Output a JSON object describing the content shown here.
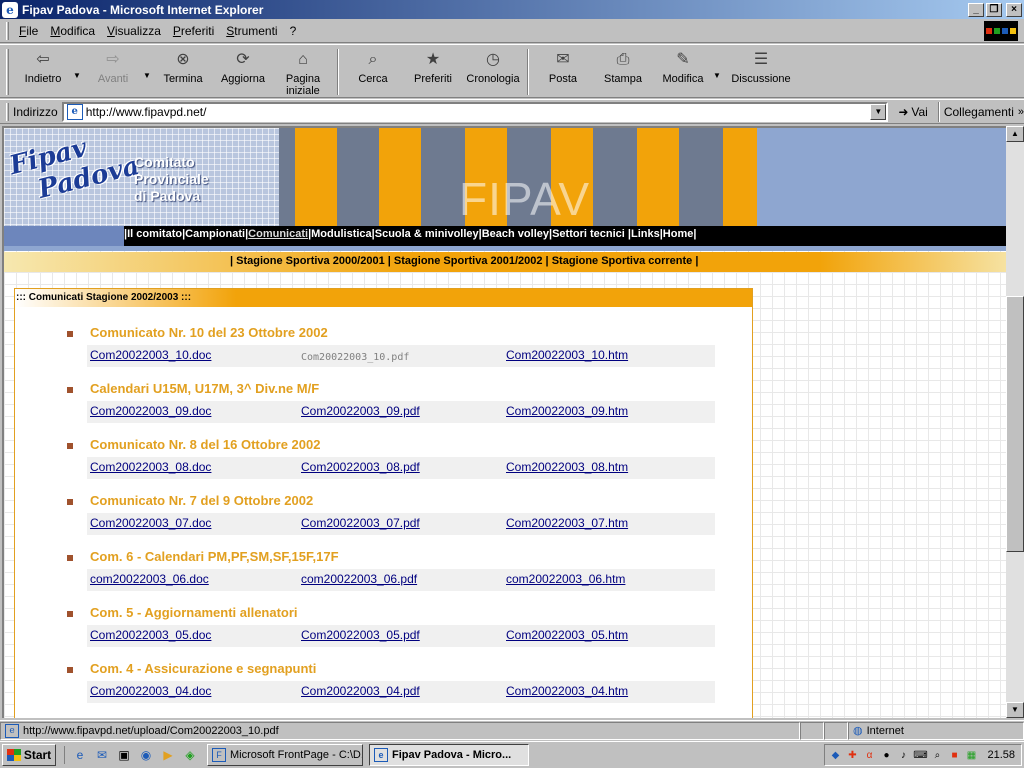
{
  "window": {
    "title": "Fipav Padova - Microsoft Internet Explorer",
    "buttons": [
      "_",
      "❐",
      "×"
    ]
  },
  "menu": [
    "File",
    "Modifica",
    "Visualizza",
    "Preferiti",
    "Strumenti",
    "?"
  ],
  "toolbar": {
    "back": "Indietro",
    "forward": "Avanti",
    "stop": "Termina",
    "refresh": "Aggiorna",
    "home": "Pagina iniziale",
    "search": "Cerca",
    "favorites": "Preferiti",
    "history": "Cronologia",
    "mail": "Posta",
    "print": "Stampa",
    "edit": "Modifica",
    "discuss": "Discussione"
  },
  "address": {
    "label": "Indirizzo",
    "url": "http://www.fipavpd.net/",
    "go": "Vai",
    "links": "Collegamenti"
  },
  "banner": {
    "logo_line1": "Fipav",
    "logo_line2": "Padova",
    "comitato": [
      "Comitato",
      "Provinciale",
      "di Padova"
    ],
    "watermark": "FIPAV"
  },
  "nav": {
    "items": [
      "Il comitato",
      "Campionati",
      "Comunicati",
      "Modulistica",
      "Scuola & minivolley",
      "Beach volley",
      "Settori tecnici",
      "Links",
      "Home"
    ],
    "active": "Comunicati"
  },
  "seasons": [
    "Stagione Sportiva 2000/2001",
    "Stagione Sportiva 2001/2002",
    "Stagione Sportiva corrente"
  ],
  "panel": {
    "header": "::: Comunicati Stagione 2002/2003 :::",
    "entries": [
      {
        "title": "Comunicato Nr. 10 del 23 Ottobre 2002",
        "doc": "Com20022003_10.doc",
        "pdf": "Com20022003_10.pdf",
        "htm": "Com20022003_10.htm"
      },
      {
        "title": "Calendari U15M, U17M, 3^ Div.ne M/F",
        "doc": "Com20022003_09.doc",
        "pdf": "Com20022003_09.pdf",
        "htm": "Com20022003_09.htm"
      },
      {
        "title": "Comunicato Nr. 8 del 16 Ottobre 2002",
        "doc": "Com20022003_08.doc",
        "pdf": "Com20022003_08.pdf",
        "htm": "Com20022003_08.htm"
      },
      {
        "title": "Comunicato Nr. 7 del 9 Ottobre 2002",
        "doc": "Com20022003_07.doc",
        "pdf": "Com20022003_07.pdf",
        "htm": "Com20022003_07.htm"
      },
      {
        "title": "Com. 6 - Calendari PM,PF,SM,SF,15F,17F",
        "doc": "com20022003_06.doc",
        "pdf": "com20022003_06.pdf",
        "htm": "com20022003_06.htm"
      },
      {
        "title": "Com. 5 - Aggiornamenti allenatori",
        "doc": "Com20022003_05.doc",
        "pdf": "Com20022003_05.pdf",
        "htm": "Com20022003_05.htm"
      },
      {
        "title": "Com. 4 - Assicurazione e segnapunti",
        "doc": "Com20022003_04.doc",
        "pdf": "Com20022003_04.pdf",
        "htm": "Com20022003_04.htm"
      }
    ]
  },
  "status": {
    "text": "http://www.fipavpd.net/upload/Com20022003_10.pdf",
    "zone": "Internet"
  },
  "taskbar": {
    "start": "Start",
    "tasks": [
      "Microsoft FrontPage - C:\\D...",
      "Fipav Padova - Micro..."
    ],
    "clock": "21.58"
  },
  "colors": {
    "accent_orange": "#f2a30a",
    "title_gold": "#e2a020",
    "link_blue": "#00007f"
  }
}
